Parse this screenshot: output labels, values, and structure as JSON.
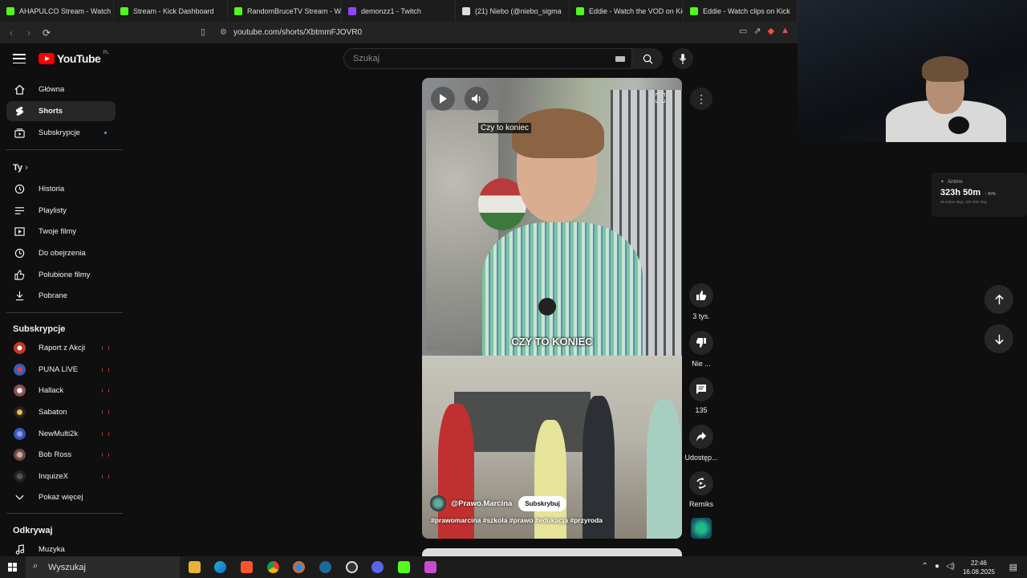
{
  "browser": {
    "tabs": [
      {
        "label": "AHAPULCO Stream - Watch Li",
        "color": "#53fc18"
      },
      {
        "label": "Stream - Kick Dashboard",
        "color": "#53fc18"
      },
      {
        "label": "RandomBruceTV Stream - Wat",
        "color": "#53fc18"
      },
      {
        "label": "demonzz1 - Twitch",
        "color": "#9146ff"
      },
      {
        "label": "(21) Niebo (@niebo_sigma",
        "color": "#ffffff"
      },
      {
        "label": "Eddie - Watch the VOD on Kick",
        "color": "#53fc18"
      },
      {
        "label": "Eddie - Watch clips on Kick",
        "color": "#53fc18"
      }
    ],
    "url": "youtube.com/shorts/XbtmmFJOVR0"
  },
  "overlay": {
    "airtime_label": "Airtime",
    "airtime_value": "323h 50m",
    "airtime_pct": "↑ 40%",
    "airtime_sub": "29 active days, 11h 10m /day"
  },
  "header": {
    "logo_text": "YouTube",
    "country": "PL",
    "search_placeholder": "Szukaj"
  },
  "sidebar": {
    "main": [
      {
        "label": "Główna",
        "icon": "home-icon"
      },
      {
        "label": "Shorts",
        "icon": "shorts-icon"
      },
      {
        "label": "Subskrypcje",
        "icon": "subscriptions-icon"
      }
    ],
    "you_title": "Ty",
    "you": [
      {
        "label": "Historia",
        "icon": "history-icon"
      },
      {
        "label": "Playlisty",
        "icon": "playlist-icon"
      },
      {
        "label": "Twoje filmy",
        "icon": "your-videos-icon"
      },
      {
        "label": "Do obejrzenia",
        "icon": "watch-later-icon"
      },
      {
        "label": "Polubione filmy",
        "icon": "liked-icon"
      },
      {
        "label": "Pobrane",
        "icon": "download-icon"
      }
    ],
    "subs_title": "Subskrypcje",
    "subs": [
      {
        "label": "Raport z Akcji",
        "color": "#c0392b"
      },
      {
        "label": "PUNA LIVE",
        "color": "#3b5bb5"
      },
      {
        "label": "Hallack",
        "color": "#8a5050"
      },
      {
        "label": "Sabaton",
        "color": "#c9a227"
      },
      {
        "label": "NewMulti2k",
        "color": "#3355aa"
      },
      {
        "label": "Bob Ross",
        "color": "#6b4a3a"
      },
      {
        "label": "InquizeX",
        "color": "#333333"
      }
    ],
    "show_more": "Pokaż więcej",
    "explore_title": "Odkrywaj",
    "music": "Muzyka"
  },
  "short": {
    "caption_top": "Czy to koniec",
    "caption_big": "CZY TO KONIEC",
    "channel": "@Prawo.Marcina",
    "subscribe": "Subskrybuj",
    "hashtags": "#prawomarcina #szkola #prawo #edukacja #przyroda"
  },
  "actions": {
    "likes": "3 tys.",
    "dislike": "Nie ...",
    "comments": "135",
    "share": "Udostęp...",
    "remix": "Remiks"
  },
  "taskbar": {
    "search": "Wyszukaj",
    "time": "22:46",
    "date": "16.08.2025"
  }
}
